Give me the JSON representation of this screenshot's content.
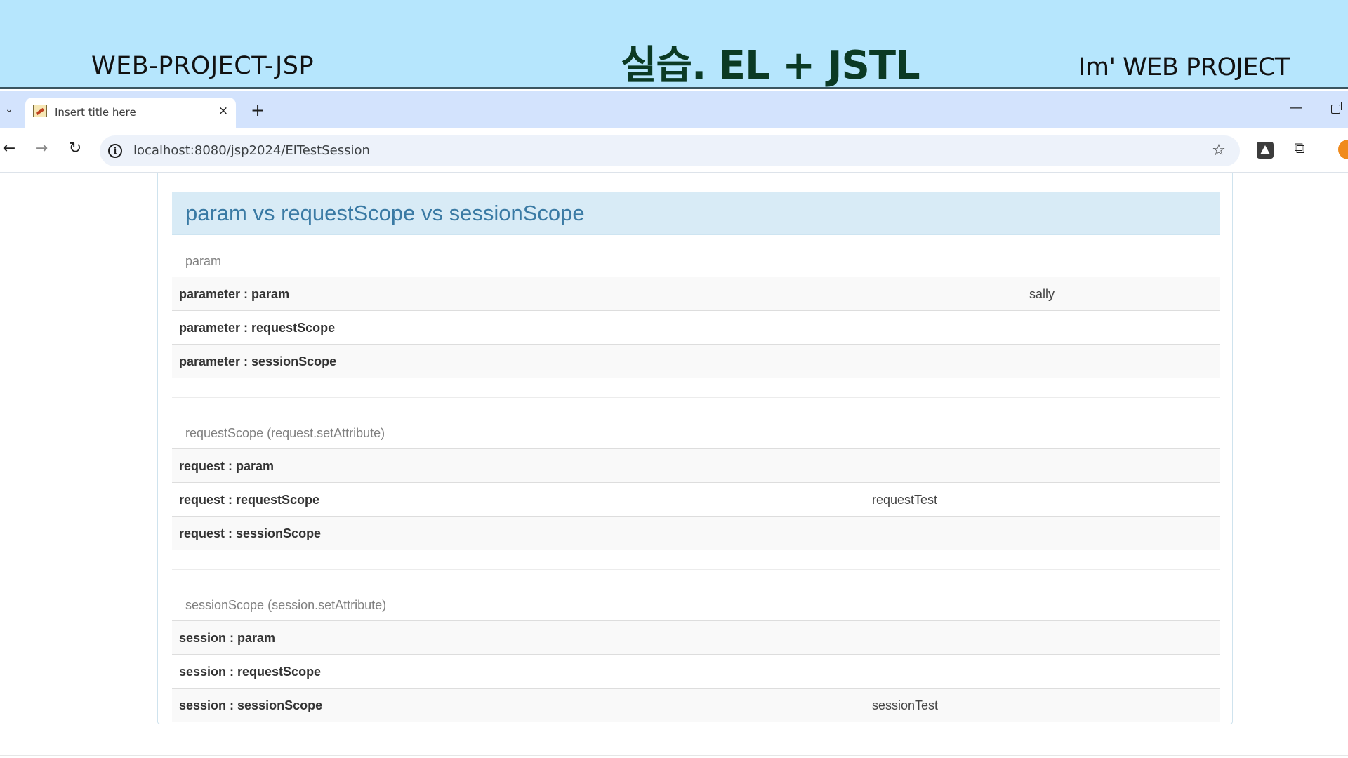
{
  "slide": {
    "left_title": "WEB-PROJECT-JSP",
    "center_title": "실습. EL + JSTL",
    "right_title": "Im' WEB PROJECT",
    "background_color": "#b6e6fd"
  },
  "browser": {
    "tab": {
      "title": "Insert title here",
      "close_glyph": "×",
      "favicon": "jsp-favicon-icon"
    },
    "new_tab_glyph": "+",
    "tab_list_glyph": "⌄",
    "window_controls": {
      "minimize_glyph": "—",
      "restore": "restore-icon"
    },
    "nav": {
      "back_glyph": "←",
      "forward_glyph": "→",
      "reload_glyph": "↻"
    },
    "address_bar": {
      "url": "localhost:8080/jsp2024/ElTestSession",
      "info_glyph": "i"
    },
    "bookmark_glyph": "☆",
    "extensions_glyph": "⧉"
  },
  "page": {
    "panel_title": "param vs requestScope vs sessionScope",
    "panel_color": "#d8ebf6",
    "sections": [
      {
        "caption": "param",
        "rows": [
          {
            "label": "parameter : param",
            "value": "sally"
          },
          {
            "label": "parameter : requestScope",
            "value": ""
          },
          {
            "label": "parameter : sessionScope",
            "value": ""
          }
        ]
      },
      {
        "caption": "requestScope (request.setAttribute)",
        "rows": [
          {
            "label": "request : param",
            "value": ""
          },
          {
            "label": "request : requestScope",
            "value": "requestTest"
          },
          {
            "label": "request : sessionScope",
            "value": ""
          }
        ]
      },
      {
        "caption": "sessionScope (session.setAttribute)",
        "rows": [
          {
            "label": "session : param",
            "value": ""
          },
          {
            "label": "session : requestScope",
            "value": ""
          },
          {
            "label": "session : sessionScope",
            "value": "sessionTest"
          }
        ]
      }
    ]
  }
}
